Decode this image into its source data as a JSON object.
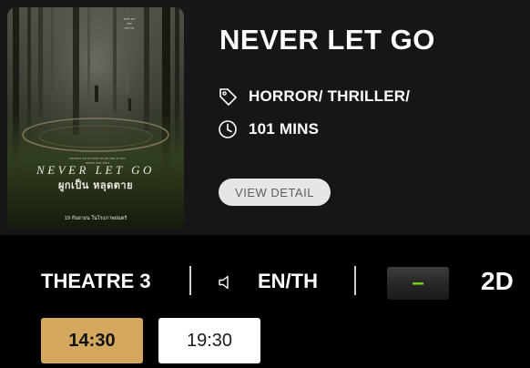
{
  "movie": {
    "title": "NEVER LET GO",
    "genre": "HORROR/ THRILLER/",
    "duration": "101 MINS",
    "view_detail_label": "VIEW DETAIL",
    "genre_icon": "tag-icon",
    "duration_icon": "clock-icon",
    "poster": {
      "title_en": "NEVER LET GO",
      "title_th": "ผูกเป็น หลุดตาย",
      "date_line": "19 กันยายน ในโรงภาพยนตร์"
    }
  },
  "theatre": {
    "name": "THEATRE 3",
    "audio_icon": "speaker-icon",
    "audio_language": "EN/TH",
    "rating": "–",
    "format": "2D"
  },
  "showtimes": [
    {
      "time": "14:30",
      "selected": true
    },
    {
      "time": "19:30",
      "selected": false
    }
  ],
  "colors": {
    "card_background": "#161616",
    "page_background": "#000000",
    "selected_showtime": "#d4a95f",
    "rating_accent": "#7ed221",
    "view_detail_button": "#e6e6e6"
  }
}
